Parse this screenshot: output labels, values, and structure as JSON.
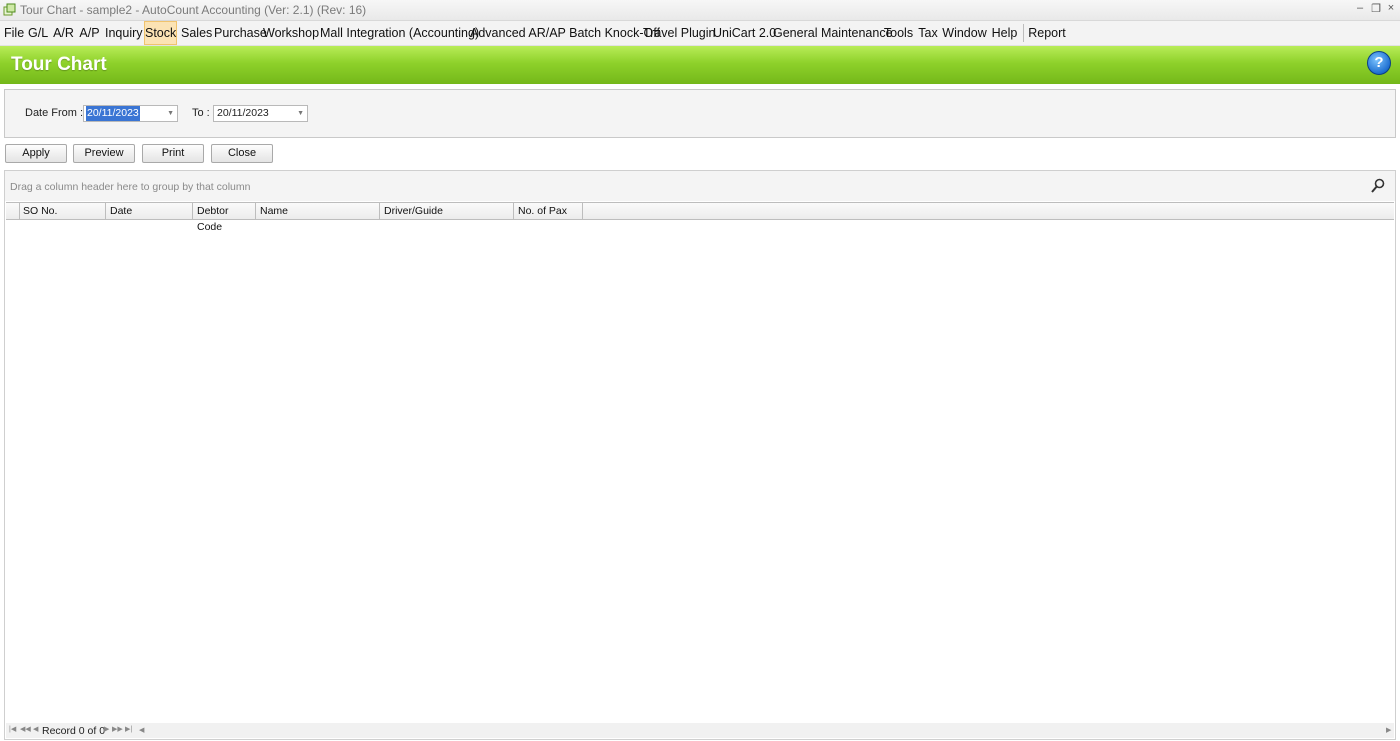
{
  "window": {
    "title": "Tour Chart - sample2 - AutoCount Accounting (Ver: 2.1) (Rev: 16)",
    "controls": [
      "–",
      "❐",
      "×"
    ]
  },
  "menu": {
    "items": [
      "File",
      "G/L",
      "A/R",
      "A/P",
      "Inquiry",
      "Stock",
      "Sales",
      "Purchase",
      "Workshop",
      "Mall Integration (Accounting)",
      "Advanced AR/AP Batch Knock-Off",
      "Travel Plugin",
      "UniCart 2.0",
      "General Maintenance",
      "Tools",
      "Tax",
      "Window",
      "Help",
      "Report"
    ],
    "active": "Stock"
  },
  "banner": {
    "title": "Tour Chart",
    "help_icon": "?",
    "accent_color": "#8ed12a"
  },
  "filters": {
    "date_from_label": "Date From :",
    "date_from_value": "20/11/2023",
    "to_label": "To :",
    "to_value": "20/11/2023"
  },
  "buttons": {
    "apply": "Apply",
    "preview": "Preview",
    "print": "Print",
    "close": "Close"
  },
  "grid": {
    "group_hint": "Drag a column header here to group by that column",
    "columns": [
      "SO No.",
      "Date",
      "Debtor Code",
      "Name",
      "Driver/Guide",
      "No. of Pax"
    ],
    "rows": [],
    "record_text": "Record 0 of 0"
  }
}
